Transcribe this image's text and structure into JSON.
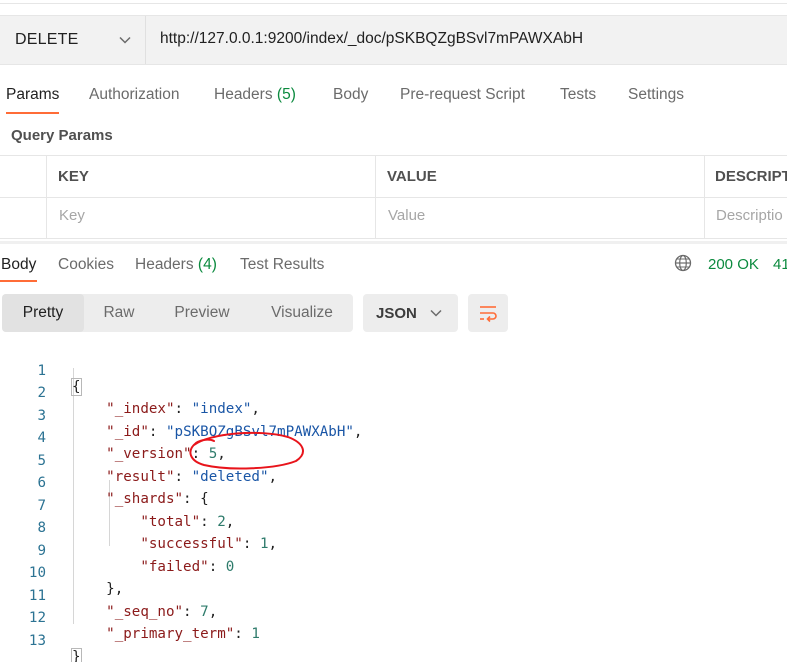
{
  "request": {
    "method": "DELETE",
    "url": "http://127.0.0.1:9200/index/_doc/pSKBQZgBSvl7mPAWXAbH"
  },
  "request_tabs": [
    {
      "label": "Params",
      "count": ""
    },
    {
      "label": "Authorization",
      "count": ""
    },
    {
      "label": "Headers",
      "count": "(5)"
    },
    {
      "label": "Body",
      "count": ""
    },
    {
      "label": "Pre-request Script",
      "count": ""
    },
    {
      "label": "Tests",
      "count": ""
    },
    {
      "label": "Settings",
      "count": ""
    }
  ],
  "query_params": {
    "title": "Query Params",
    "columns": [
      "KEY",
      "VALUE",
      "DESCRIPT"
    ],
    "placeholders": [
      "Key",
      "Value",
      "Descriptio"
    ]
  },
  "response_tabs": [
    {
      "label": "Body",
      "count": ""
    },
    {
      "label": "Cookies",
      "count": ""
    },
    {
      "label": "Headers",
      "count": "(4)"
    },
    {
      "label": "Test Results",
      "count": ""
    }
  ],
  "response_status": {
    "status": "200 OK",
    "time": "41"
  },
  "view_modes": [
    "Pretty",
    "Raw",
    "Preview",
    "Visualize"
  ],
  "format": "JSON",
  "icons": {
    "method_dropdown": "chevron-down-icon",
    "globe": "globe-icon",
    "format_dropdown": "chevron-down-icon",
    "wrap": "wrap-lines-icon"
  },
  "colors": {
    "accent": "#ff6c37",
    "status_ok": "#0b8a3e",
    "json_key": "#8b1a1a",
    "json_string": "#1a56a6",
    "json_number": "#2e7b6b",
    "annotation": "#e8141b"
  },
  "code_lines": [
    {
      "no": "1",
      "text": "{"
    },
    {
      "no": "2",
      "text": "    \"_index\": \"index\","
    },
    {
      "no": "3",
      "text": "    \"_id\": \"pSKBQZgBSvl7mPAWXAbH\","
    },
    {
      "no": "4",
      "text": "    \"_version\": 5,"
    },
    {
      "no": "5",
      "text": "    \"result\": \"deleted\","
    },
    {
      "no": "6",
      "text": "    \"_shards\": {"
    },
    {
      "no": "7",
      "text": "        \"total\": 2,"
    },
    {
      "no": "8",
      "text": "        \"successful\": 1,"
    },
    {
      "no": "9",
      "text": "        \"failed\": 0"
    },
    {
      "no": "10",
      "text": "    },"
    },
    {
      "no": "11",
      "text": "    \"_seq_no\": 7,"
    },
    {
      "no": "12",
      "text": "    \"_primary_term\": 1"
    },
    {
      "no": "13",
      "text": "}"
    }
  ]
}
